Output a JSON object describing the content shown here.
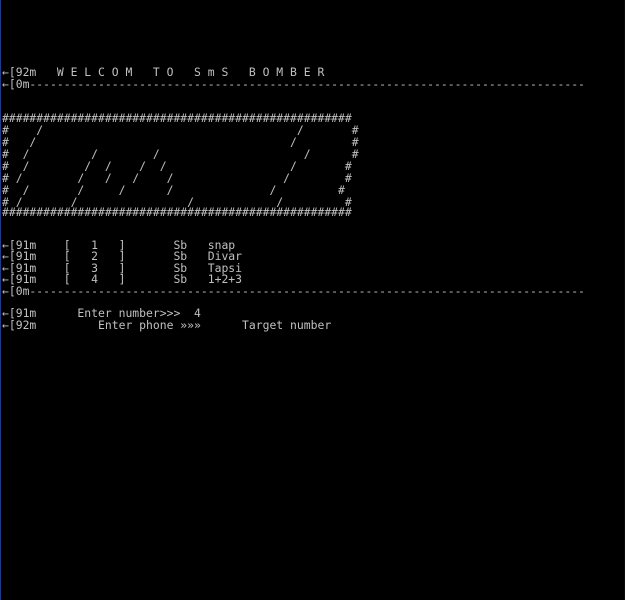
{
  "console": {
    "colors": {
      "background": "#000000",
      "foreground": "#c0c0c0"
    },
    "lines": [
      {
        "name": "welcome-line",
        "text": "←[92m   W E L C O M   T O   S m S   B O M B E R"
      },
      {
        "name": "separator-line-top",
        "text": "←[0m---------------------------------------------------------------------------------"
      },
      {
        "name": "banner-top-border",
        "text": "###################################################"
      },
      {
        "name": "banner-row-1",
        "text": "#    /                                     /       #"
      },
      {
        "name": "banner-row-2",
        "text": "#   /                                     /        #"
      },
      {
        "name": "banner-row-3",
        "text": "#  /         /        /                     /      #"
      },
      {
        "name": "banner-row-4",
        "text": "#  /        /  /    /  /                  /       #"
      },
      {
        "name": "banner-row-5",
        "text": "# /        /   /   /    /                /        #"
      },
      {
        "name": "banner-row-6",
        "text": "#  /       /     /      /              /         #"
      },
      {
        "name": "banner-row-7",
        "text": "# /       /                /            /         #"
      },
      {
        "name": "banner-bottom-border",
        "text": "###################################################"
      },
      {
        "name": "menu-option-1",
        "text": "←[91m    [   1   ]       Sb   snap"
      },
      {
        "name": "menu-option-2",
        "text": "←[91m    [   2   ]       Sb   Divar"
      },
      {
        "name": "menu-option-3",
        "text": "←[91m    [   3   ]       Sb   Tapsi"
      },
      {
        "name": "menu-option-4",
        "text": "←[91m    [   4   ]       Sb   1+2+3"
      },
      {
        "name": "separator-line-bottom",
        "text": "←[0m---------------------------------------------------------------------------------"
      },
      {
        "name": "enter-number-prompt",
        "text": "←[91m      Enter number>>>  4"
      },
      {
        "name": "enter-phone-prompt",
        "text": "←[92m         Enter phone »»»      Target number"
      }
    ]
  }
}
